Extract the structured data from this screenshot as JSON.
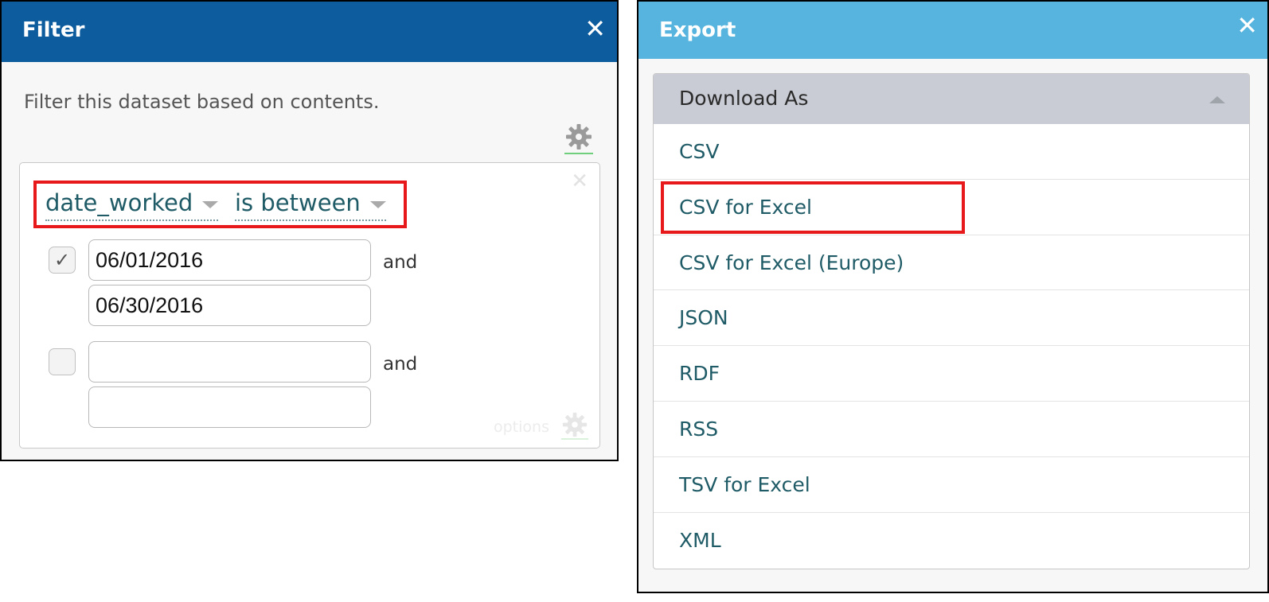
{
  "filter": {
    "title": "Filter",
    "close_glyph": "✕",
    "description": "Filter this dataset based on contents.",
    "column_picker": "date_worked",
    "operator_picker": "is between",
    "remove_glyph": "✕",
    "conditions": [
      {
        "checked": true,
        "check_glyph": "✓",
        "start": "06/01/2016",
        "end": "06/30/2016",
        "joiner": "and"
      },
      {
        "checked": false,
        "check_glyph": "",
        "start": "",
        "end": "",
        "joiner": "and"
      }
    ],
    "options_label": "options",
    "header_color": "#0d5c9e"
  },
  "export": {
    "title": "Export",
    "close_glyph": "✕",
    "download_header": "Download As",
    "formats": [
      "CSV",
      "CSV for Excel",
      "CSV for Excel (Europe)",
      "JSON",
      "RDF",
      "RSS",
      "TSV for Excel",
      "XML"
    ],
    "header_color": "#56b4de"
  },
  "highlight_color": "#e8191b"
}
